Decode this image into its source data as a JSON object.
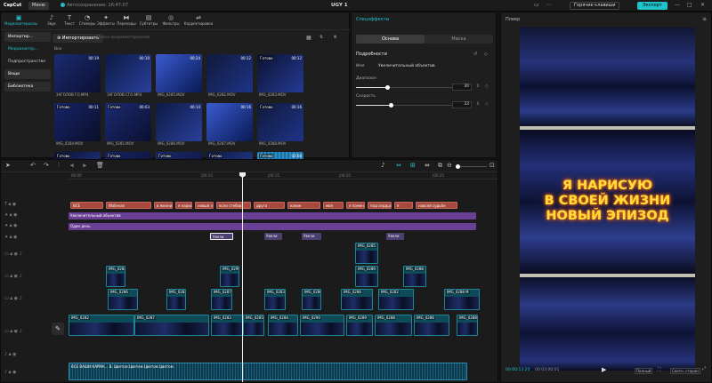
{
  "titlebar": {
    "logo": "CapCut",
    "menu": "Меню",
    "autosave": "Автосохранение: 16:47:07",
    "project_title": "UGY 1",
    "hotkeys": "Горячие клавиши",
    "export": "Экспорт"
  },
  "media": {
    "tools": [
      {
        "icon": "media-icon",
        "label": "Медиаматериалы",
        "active": true
      },
      {
        "icon": "audio-icon",
        "label": "Звук"
      },
      {
        "icon": "text-icon",
        "label": "Текст"
      },
      {
        "icon": "stickers-icon",
        "label": "Стикеры"
      },
      {
        "icon": "effects-icon",
        "label": "Эффекты"
      },
      {
        "icon": "transitions-icon",
        "label": "Переходы"
      },
      {
        "icon": "subtitles-icon",
        "label": "Субтитры"
      },
      {
        "icon": "filters-icon",
        "label": "Фильтры"
      },
      {
        "icon": "adjust-icon",
        "label": "Корректировка"
      }
    ],
    "sidenav": [
      "Импортир...",
      "Медиаматер...",
      "Подпространство",
      "Вещи",
      "Библиотека"
    ],
    "import_button": "Импортировать",
    "search_placeholder": "Поиск медиаматериалов",
    "all_label": "Все",
    "thumbs": [
      {
        "name": "ЗАГОЛОВ ГО.MP4",
        "dur": "00:19",
        "done": ""
      },
      {
        "name": "ЗАГОЛОВ СГО.MP4",
        "dur": "00:10",
        "done": ""
      },
      {
        "name": "IMG_0285.MOV",
        "dur": "00:24",
        "done": ""
      },
      {
        "name": "IMG_0282.MOV",
        "dur": "00:12",
        "done": ""
      },
      {
        "name": "IMG_0283.MOV",
        "dur": "00:12",
        "done": "Готово"
      },
      {
        "name": "IMG_0284.MOV",
        "dur": "00:11",
        "done": "Готово"
      },
      {
        "name": "IMG_0285.MOV",
        "dur": "00:03",
        "done": "Готово"
      },
      {
        "name": "IMG_0286.MOV",
        "dur": "00:14",
        "done": ""
      },
      {
        "name": "IMG_0287.MOV",
        "dur": "00:16",
        "done": ""
      },
      {
        "name": "IMG_0288.MOV",
        "dur": "00:16",
        "done": "Готово"
      },
      {
        "name": "",
        "dur": "",
        "done": "Готово"
      },
      {
        "name": "",
        "dur": "",
        "done": "Готово"
      },
      {
        "name": "",
        "dur": "",
        "done": "Готово"
      },
      {
        "name": "",
        "dur": "",
        "done": "Готово"
      },
      {
        "name": "",
        "dur": "02:08",
        "done": "Готово"
      }
    ]
  },
  "props": {
    "title": "Спецэффекты",
    "tab_basic": "Основа",
    "tab_mask": "Маска",
    "subtitle": "Подробности",
    "name_label": "Имя",
    "name_value": "Увеличительный объектив",
    "range_label": "Диапазон",
    "range_value": "30",
    "speed_label": "Скорость",
    "speed_value": "33",
    "range_fraction": 0.3,
    "speed_fraction": 0.33
  },
  "player": {
    "title": "Плеер",
    "caption_lines": [
      "Я НАРИСУЮ",
      "В СВОЕЙ ЖИЗНИ",
      "НОВЫЙ ЭПИЗОД"
    ],
    "timecode": "00:00:13:20",
    "duration": "00:03:00:01",
    "original_btn": "Полный",
    "ratio_btn": "Соотн. сторон"
  },
  "timeline": {
    "ruler": [
      "00:00",
      "|00:10",
      "|00:15",
      "|00:20",
      "|00:25"
    ],
    "text_clips": [
      "ВСЕ",
      "Wollevan",
      "в жизни",
      "я нарисую",
      "новый эпизод",
      "если стебов",
      "друга",
      "какие",
      "моя",
      "я поменяю",
      "под сердце",
      "я",
      "навсей судьбе"
    ],
    "effect_track_1": "Увеличительный объектив",
    "effect_track_2": "Один день",
    "small_effects": [
      "Увели",
      "Увели",
      "Увели",
      "Увели"
    ],
    "clip_labels": [
      "IMG_0285",
      "IMG_0284",
      "IMG_0290",
      "IMG_0289",
      "IMG_0288",
      "IMG_0286",
      "IMG_0282",
      "IMG_0287",
      "IMG_0283",
      "IMG_0286 M",
      "IMG_0288 M",
      "IMG_0288 M"
    ],
    "audio_label": "ВСЕ ВАШИ КАРМА... В. Цветом Цветом Цветом Цветом"
  },
  "colors": {
    "accent": "#1fc2c9",
    "text_clip": "#a7493d",
    "effect_clip": "#6a3f96",
    "video_clip": "#0e4b59"
  }
}
